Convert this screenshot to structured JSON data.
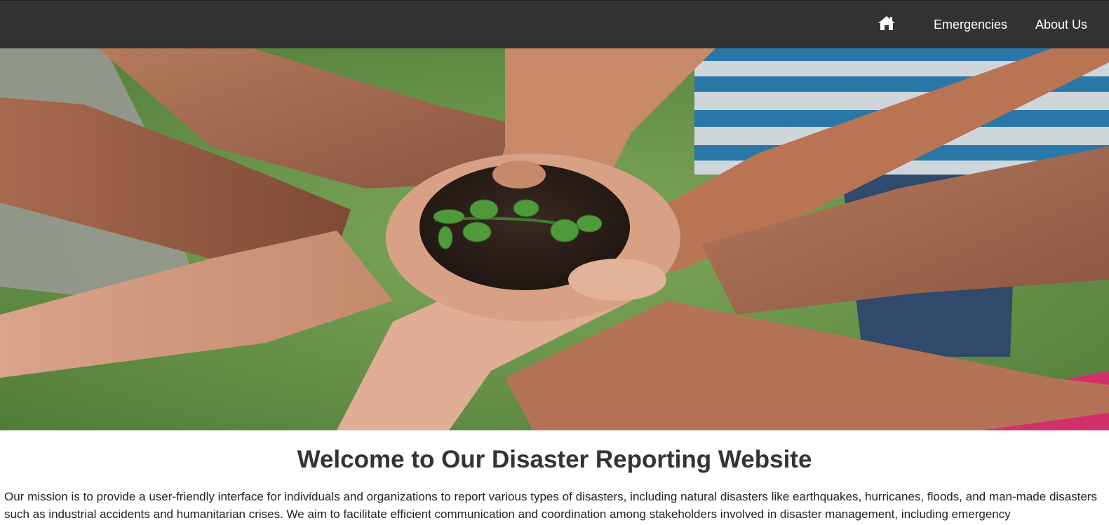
{
  "nav": {
    "home_icon": "home-icon",
    "items": [
      {
        "label": "Emergencies"
      },
      {
        "label": "About Us"
      }
    ]
  },
  "hero": {
    "image": "hands-holding-seedling-photo"
  },
  "main": {
    "title": "Welcome to Our Disaster Reporting Website",
    "mission": "Our mission is to provide a user-friendly interface for individuals and organizations to report various types of disasters, including natural disasters like earthquakes, hurricanes, floods, and man-made disasters such as industrial accidents and humanitarian crises. We aim to facilitate efficient communication and coordination among stakeholders involved in disaster management, including emergency"
  },
  "colors": {
    "navbar": "#333333",
    "nav_text": "#ffffff",
    "title_text": "#333333",
    "body_text": "#222222"
  }
}
